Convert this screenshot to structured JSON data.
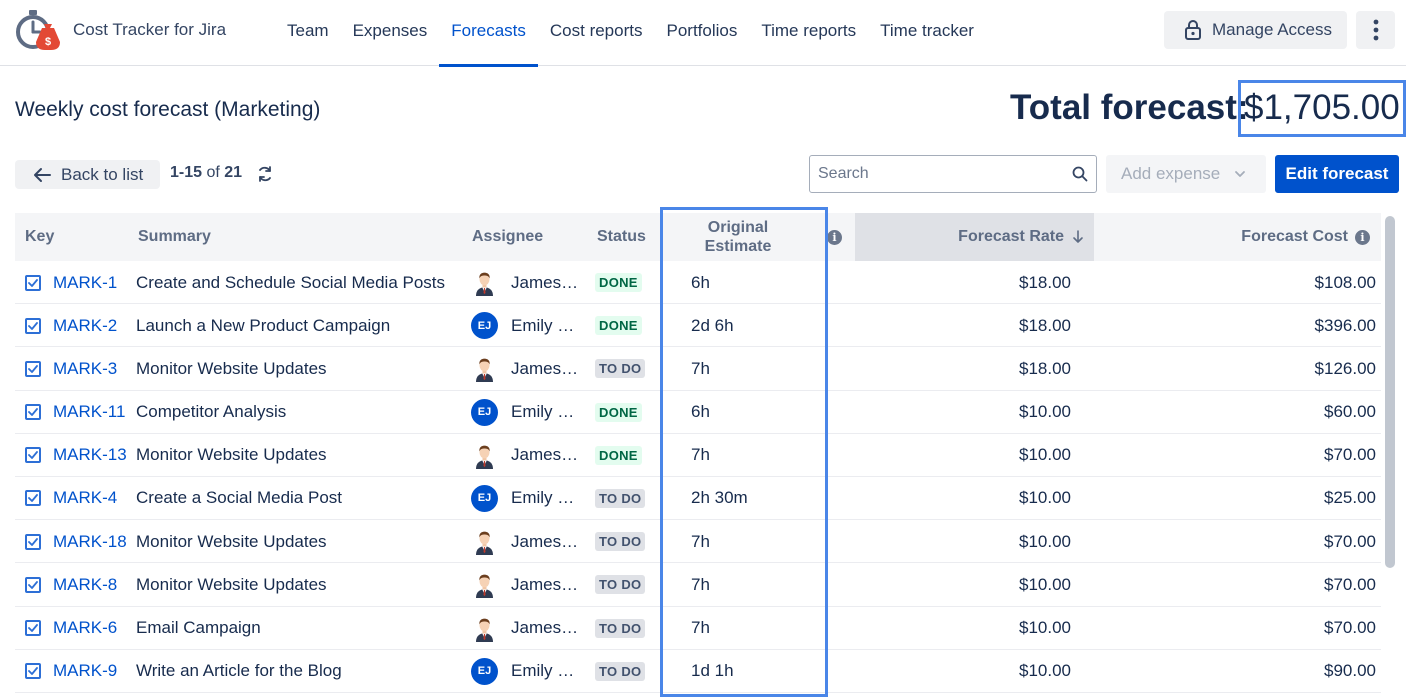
{
  "app": {
    "title": "Cost Tracker for Jira"
  },
  "nav": {
    "items": [
      "Team",
      "Expenses",
      "Forecasts",
      "Cost reports",
      "Portfolios",
      "Time reports",
      "Time tracker"
    ],
    "active": "Forecasts"
  },
  "header": {
    "manage_access": "Manage Access"
  },
  "page": {
    "title": "Weekly cost forecast (Marketing)",
    "total_label": "Total forecast:",
    "total_value": "$1,705.00"
  },
  "toolbar": {
    "back_label": "Back to list",
    "pager_range": "1-15",
    "pager_of": "of",
    "pager_total": "21",
    "search_placeholder": "Search",
    "add_expense_label": "Add expense",
    "edit_forecast_label": "Edit forecast"
  },
  "table": {
    "columns": {
      "key": "Key",
      "summary": "Summary",
      "assignee": "Assignee",
      "status": "Status",
      "original_estimate": "Original Estimate",
      "forecast_rate": "Forecast Rate",
      "forecast_cost": "Forecast Cost"
    },
    "rows": [
      {
        "key": "MARK-1",
        "summary": "Create and Schedule Social Media Posts",
        "assignee": "James ...",
        "avatar": "james",
        "status": "DONE",
        "estimate": "6h",
        "rate": "$18.00",
        "cost": "$108.00"
      },
      {
        "key": "MARK-2",
        "summary": "Launch a New Product Campaign",
        "assignee": "Emily J...",
        "avatar": "EJ",
        "status": "DONE",
        "estimate": "2d 6h",
        "rate": "$18.00",
        "cost": "$396.00"
      },
      {
        "key": "MARK-3",
        "summary": "Monitor Website Updates",
        "assignee": "James ...",
        "avatar": "james",
        "status": "TO DO",
        "estimate": "7h",
        "rate": "$18.00",
        "cost": "$126.00"
      },
      {
        "key": "MARK-11",
        "summary": "Competitor Analysis",
        "assignee": "Emily J...",
        "avatar": "EJ",
        "status": "DONE",
        "estimate": "6h",
        "rate": "$10.00",
        "cost": "$60.00"
      },
      {
        "key": "MARK-13",
        "summary": "Monitor Website Updates",
        "assignee": "James ...",
        "avatar": "james",
        "status": "DONE",
        "estimate": "7h",
        "rate": "$10.00",
        "cost": "$70.00"
      },
      {
        "key": "MARK-4",
        "summary": "Create a Social Media Post",
        "assignee": "Emily J...",
        "avatar": "EJ",
        "status": "TO DO",
        "estimate": "2h 30m",
        "rate": "$10.00",
        "cost": "$25.00"
      },
      {
        "key": "MARK-18",
        "summary": "Monitor Website Updates",
        "assignee": "James ...",
        "avatar": "james",
        "status": "TO DO",
        "estimate": "7h",
        "rate": "$10.00",
        "cost": "$70.00"
      },
      {
        "key": "MARK-8",
        "summary": "Monitor Website Updates",
        "assignee": "James ...",
        "avatar": "james",
        "status": "TO DO",
        "estimate": "7h",
        "rate": "$10.00",
        "cost": "$70.00"
      },
      {
        "key": "MARK-6",
        "summary": "Email Campaign",
        "assignee": "James ...",
        "avatar": "james",
        "status": "TO DO",
        "estimate": "7h",
        "rate": "$10.00",
        "cost": "$70.00"
      },
      {
        "key": "MARK-9",
        "summary": "Write an Article for the Blog",
        "assignee": "Emily J...",
        "avatar": "EJ",
        "status": "TO DO",
        "estimate": "1d 1h",
        "rate": "$10.00",
        "cost": "$90.00"
      }
    ]
  },
  "colors": {
    "accent": "#0052cc",
    "highlight": "#4a86e8",
    "done_text": "#006644",
    "done_bg": "#e3fcef",
    "todo_bg": "#dfe1e6"
  }
}
